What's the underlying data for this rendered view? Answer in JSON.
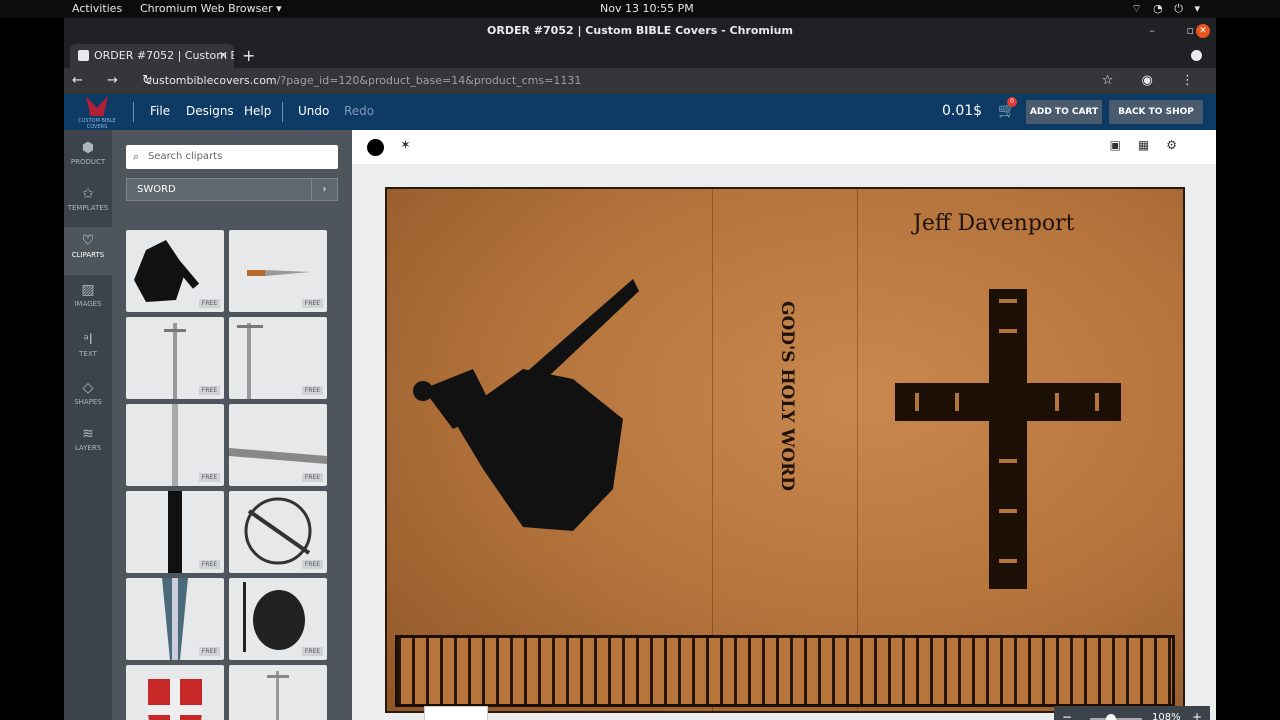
{
  "system": {
    "activities": "Activities",
    "app_name": "Chromium Web Browser ▾",
    "clock": "Nov 13  10:55 PM",
    "tray": "⌔ ◔ ⏻ ▾"
  },
  "window": {
    "title": "ORDER #7052 | Custom BIBLE Covers - Chromium",
    "controls": "– ▫"
  },
  "browser": {
    "tab_title": "ORDER #7052 | Custom B",
    "tab_close": "✕",
    "new_tab": "+",
    "nav": "← → ↻",
    "url_host": "custombiblecovers.com",
    "url_path": "/?page_id=120&product_base=14&product_cms=1131",
    "right_icons": "☆ ◉ ⋮"
  },
  "header": {
    "logo_text": "CUSTOM BIBLE COVERS",
    "menu": [
      "File",
      "Designs",
      "Help",
      "Undo",
      "Redo"
    ],
    "price": "0.01$",
    "cart_count": "0",
    "add_to_cart": "ADD TO CART",
    "back_to_shop": "BACK TO SHOP"
  },
  "rail": [
    {
      "label": "PRODUCT",
      "icon": "⬢"
    },
    {
      "label": "TEMPLATES",
      "icon": "✩"
    },
    {
      "label": "CLIPARTS",
      "icon": "♡"
    },
    {
      "label": "IMAGES",
      "icon": "▨"
    },
    {
      "label": "TEXT",
      "icon": "ᵃI"
    },
    {
      "label": "SHAPES",
      "icon": "◇"
    },
    {
      "label": "LAYERS",
      "icon": "≋"
    }
  ],
  "panel": {
    "search_placeholder": "Search cliparts",
    "category": "SWORD",
    "free_label": "FREE"
  },
  "canvas": {
    "name_text": "Jeff Davenport",
    "spine_text": "GOD'S HOLY WORD",
    "zoom_level": "108%"
  }
}
